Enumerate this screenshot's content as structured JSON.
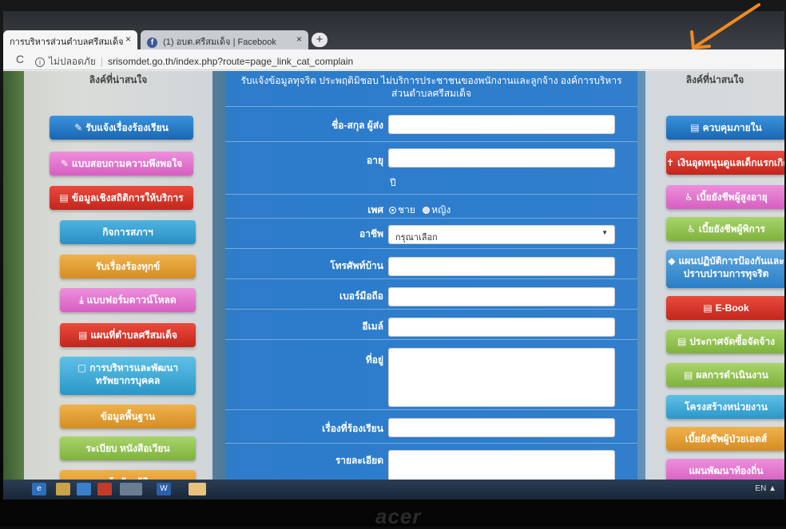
{
  "browser": {
    "tabs": [
      {
        "label": "การบริหารส่วนตำบลศรีสมเด็จ",
        "close": "×"
      },
      {
        "label": "(1) อบต.ศรีสมเด็จ | Facebook",
        "close": "×"
      }
    ],
    "new_tab": "+",
    "reload": "C",
    "security_label": "ไม่ปลอดภัย",
    "url": "srisomdet.go.th/index.php?route=page_link_cat_complain"
  },
  "left_column": {
    "title": "ลิงค์ที่น่าสนใจ",
    "buttons": [
      {
        "icon": "✎",
        "label": "รับแจ้งเรื่องร้องเรียน"
      },
      {
        "icon": "✎",
        "label": "แบบสอบถามความพึงพอใจ"
      },
      {
        "icon": "▤",
        "label": "ข้อมูลเชิงสถิติการให้บริการ"
      },
      {
        "icon": "",
        "label": "กิจการสภาฯ"
      },
      {
        "icon": "",
        "label": "รับเรื่องร้องทุกข์"
      },
      {
        "icon": "⤓",
        "label": "แบบฟอร์มดาวน์โหลด"
      },
      {
        "icon": "▤",
        "label": "แผนที่ตำบลศรีสมเด็จ"
      },
      {
        "icon": "▢",
        "label": "การบริหารและพัฒนาทรัพยากรบุคคล"
      },
      {
        "icon": "",
        "label": "ข้อมูลพื้นฐาน"
      },
      {
        "icon": "",
        "label": "ระเบียบ หนังสือเวียน"
      },
      {
        "icon": "",
        "label": "ข้อบัญญัติ"
      }
    ]
  },
  "right_column": {
    "title": "ลิงค์ที่น่าสนใจ",
    "buttons": [
      {
        "icon": "▤",
        "label": "ควบคุมภายใน"
      },
      {
        "icon": "✝",
        "label": "เงินอุดหนุนดูแลเด็กแรกเกิด"
      },
      {
        "icon": "♿",
        "label": "เบี้ยยังชีพผู้สูงอายุ"
      },
      {
        "icon": "♿",
        "label": "เบี้ยยังชีพผู้พิการ"
      },
      {
        "icon": "◆",
        "label": "แผนปฏิบัติการป้องกันและปราบปรามการทุจริต"
      },
      {
        "icon": "▤",
        "label": "E-Book"
      },
      {
        "icon": "▤",
        "label": "ประกาศจัดซื้อจัดจ้าง"
      },
      {
        "icon": "▤",
        "label": "ผลการดำเนินงาน"
      },
      {
        "icon": "",
        "label": "โครงสร้างหน่วยงาน"
      },
      {
        "icon": "",
        "label": "เบี้ยยังชีพผู้ป่วยเอดส์"
      },
      {
        "icon": "",
        "label": "แผนพัฒนาท้องถิ่น"
      }
    ]
  },
  "form": {
    "heading": "รับแจ้งข้อมูลทุจริต ประพฤติมิชอบ ไม่บริการประชาชนของพนักงานและลูกจ้าง องค์การบริหารส่วนตำบลศรีสมเด็จ",
    "fields": {
      "name_label": "ชื่อ-สกุล ผู้ส่ง",
      "age_label": "อายุ",
      "age_unit": "ปี",
      "gender_label": "เพศ",
      "gender_male": "ชาย",
      "gender_female": "หญิง",
      "occupation_label": "อาชีพ",
      "occupation_value": "กรุณาเลือก",
      "phone_label": "โทรศัพท์บ้าน",
      "mobile_label": "เบอร์มือถือ",
      "email_label": "อีเมล์",
      "address_label": "ที่อยู่",
      "subject_label": "เรื่องที่ร้องเรียน",
      "detail_label": "รายละเอียด"
    }
  },
  "taskbar": {
    "tray_lang": "EN"
  },
  "monitor_brand": "acer",
  "colors": {
    "form_blue": "#2d7dcd",
    "btn_blue": "#1f78c8",
    "btn_pink": "#e06fc8",
    "btn_red": "#d9342a",
    "btn_cyan": "#3aa3d6",
    "btn_orange": "#e0a03a",
    "btn_green": "#8fc046",
    "annotation_arrow": "#f08a24"
  }
}
